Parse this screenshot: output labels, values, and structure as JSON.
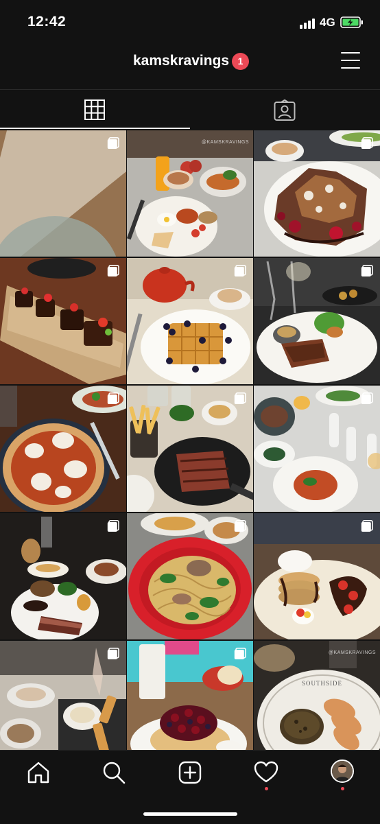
{
  "status_bar": {
    "time": "12:42",
    "network": "4G"
  },
  "header": {
    "username": "kamskravings",
    "notification_count": "1"
  },
  "tabs": [
    {
      "name": "grid",
      "icon": "grid-icon",
      "active": true
    },
    {
      "name": "tagged",
      "icon": "tagged-person-icon",
      "active": false
    }
  ],
  "grid": {
    "watermark": "@KAMSKRAVINGS",
    "posts": [
      {
        "subject": "burgers",
        "multiple": true
      },
      {
        "subject": "full breakfast with tea",
        "multiple": false
      },
      {
        "subject": "french toast with berries",
        "multiple": true
      },
      {
        "subject": "brownies on board",
        "multiple": true
      },
      {
        "subject": "waffles with berries and teapot",
        "multiple": true
      },
      {
        "subject": "steak with salad",
        "multiple": true
      },
      {
        "subject": "margherita pizza",
        "multiple": true
      },
      {
        "subject": "steak with fries",
        "multiple": true
      },
      {
        "subject": "dinner table spread",
        "multiple": true
      },
      {
        "subject": "steak dinner by candlelight",
        "multiple": true
      },
      {
        "subject": "noodles in red bowl",
        "multiple": true
      },
      {
        "subject": "pancake stack with strawberries",
        "multiple": true
      },
      {
        "subject": "brunch table with wine",
        "multiple": true
      },
      {
        "subject": "pancakes with berries and milkshake",
        "multiple": true
      },
      {
        "subject": "southside steak tartare",
        "multiple": true
      }
    ]
  },
  "bottom_nav": [
    {
      "name": "home",
      "icon": "home-icon"
    },
    {
      "name": "search",
      "icon": "search-icon"
    },
    {
      "name": "create",
      "icon": "add-post-icon"
    },
    {
      "name": "activity",
      "icon": "heart-icon",
      "notification": true
    },
    {
      "name": "profile",
      "icon": "profile-avatar",
      "notification": true
    }
  ],
  "colors": {
    "background": "#121212",
    "badge": "#ed4956",
    "text": "#ffffff"
  }
}
